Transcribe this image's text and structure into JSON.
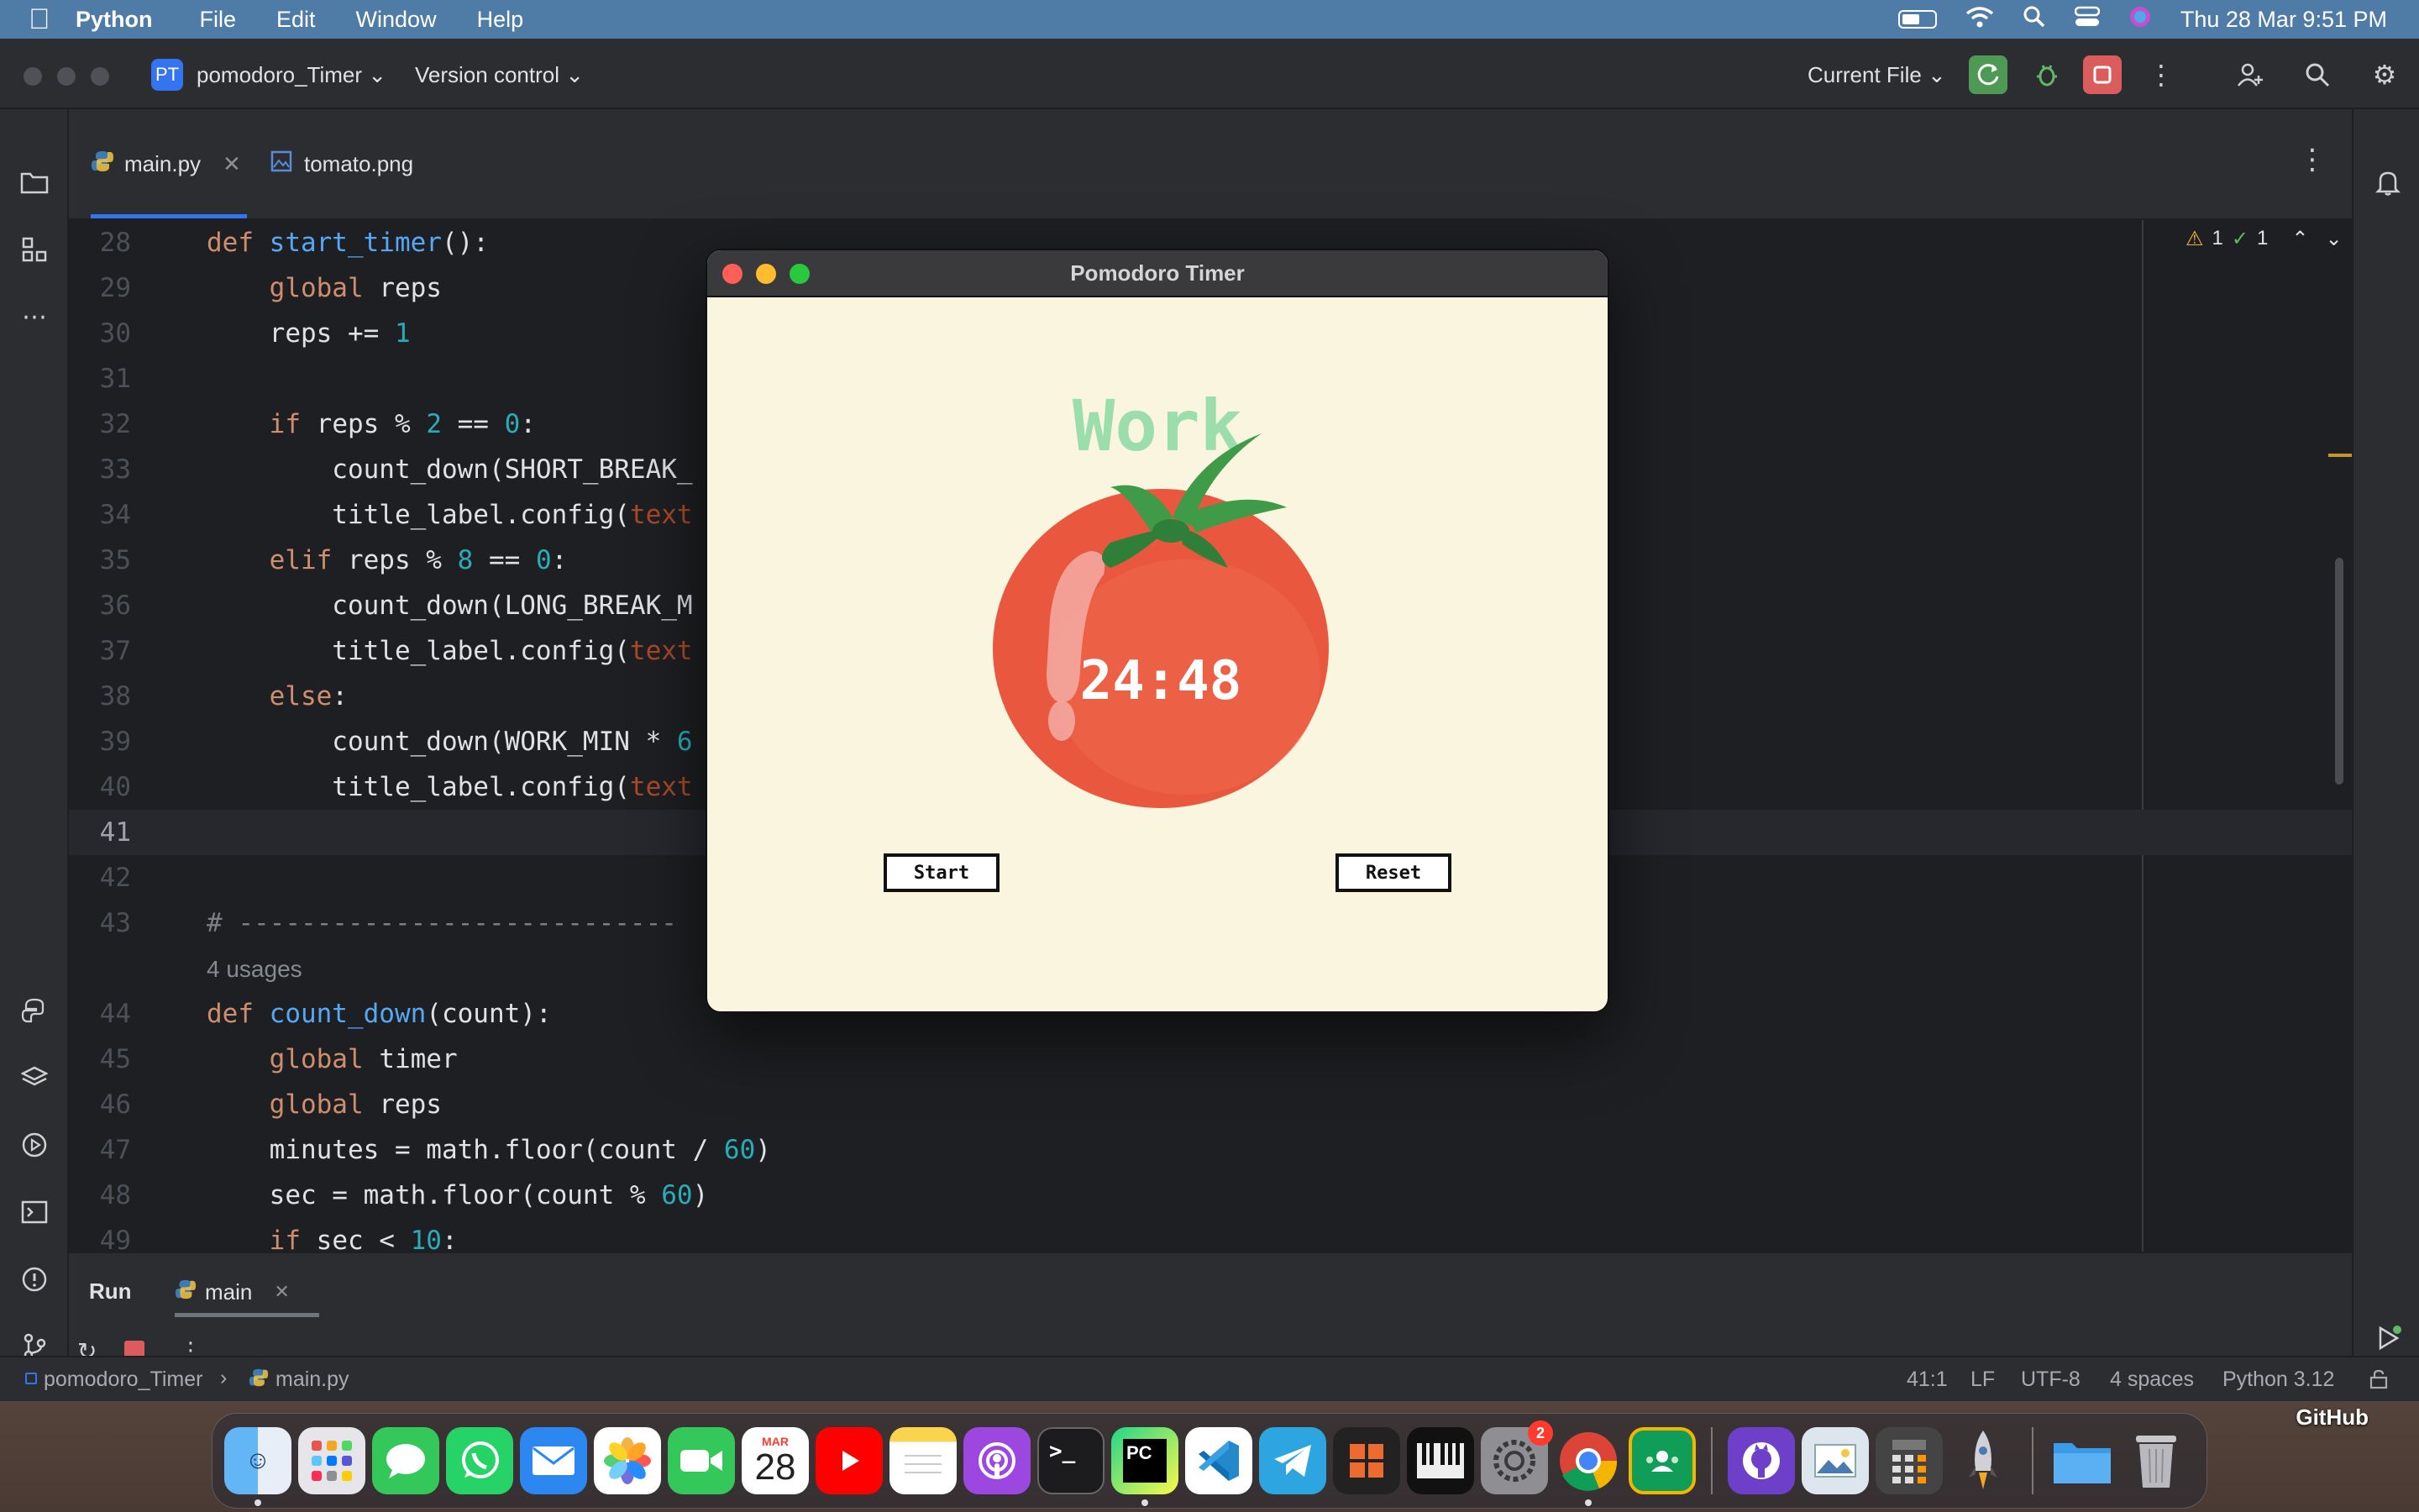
{
  "menubar": {
    "app": "Python",
    "items": [
      "File",
      "Edit",
      "Window",
      "Help"
    ],
    "datetime": "Thu 28 Mar  9:51 PM"
  },
  "ide": {
    "project_badge": "PT",
    "project_name": "pomodoro_Timer",
    "version_control": "Version control",
    "run_config": "Current File",
    "tabs": [
      {
        "label": "main.py",
        "active": true
      },
      {
        "label": "tomato.png",
        "active": false
      }
    ],
    "inspections": {
      "warnings": "1",
      "ok": "1"
    },
    "code": [
      {
        "n": "28",
        "tokens": [
          [
            "kw",
            "def "
          ],
          [
            "fn",
            "start_timer"
          ],
          [
            "",
            "():"
          ]
        ]
      },
      {
        "n": "29",
        "tokens": [
          [
            "",
            "    "
          ],
          [
            "kw",
            "global "
          ],
          [
            "",
            "reps"
          ]
        ]
      },
      {
        "n": "30",
        "tokens": [
          [
            "",
            "    reps += "
          ],
          [
            "num",
            "1"
          ]
        ]
      },
      {
        "n": "31",
        "tokens": []
      },
      {
        "n": "32",
        "tokens": [
          [
            "",
            "    "
          ],
          [
            "kw",
            "if "
          ],
          [
            "",
            "reps % "
          ],
          [
            "num",
            "2"
          ],
          [
            "",
            " == "
          ],
          [
            "num",
            "0"
          ],
          [
            "",
            ":"
          ]
        ]
      },
      {
        "n": "33",
        "tokens": [
          [
            "",
            "        count_down(SHORT_BREAK_"
          ]
        ]
      },
      {
        "n": "34",
        "tokens": [
          [
            "",
            "        title_label.config("
          ],
          [
            "kwarg",
            "text"
          ]
        ]
      },
      {
        "n": "35",
        "tokens": [
          [
            "",
            "    "
          ],
          [
            "kw",
            "elif "
          ],
          [
            "",
            "reps % "
          ],
          [
            "num",
            "8"
          ],
          [
            "",
            " == "
          ],
          [
            "num",
            "0"
          ],
          [
            "",
            ":"
          ]
        ]
      },
      {
        "n": "36",
        "tokens": [
          [
            "",
            "        count_down(LONG_BREAK_M"
          ]
        ]
      },
      {
        "n": "37",
        "tokens": [
          [
            "",
            "        title_label.config("
          ],
          [
            "kwarg",
            "text"
          ]
        ]
      },
      {
        "n": "38",
        "tokens": [
          [
            "",
            "    "
          ],
          [
            "kw",
            "else"
          ],
          [
            "",
            ":"
          ]
        ]
      },
      {
        "n": "39",
        "tokens": [
          [
            "",
            "        count_down(WORK_MIN * "
          ],
          [
            "num",
            "6"
          ]
        ]
      },
      {
        "n": "40",
        "tokens": [
          [
            "",
            "        title_label.config("
          ],
          [
            "kwarg",
            "text"
          ]
        ]
      },
      {
        "n": "41",
        "tokens": [],
        "current": true
      },
      {
        "n": "42",
        "tokens": []
      },
      {
        "n": "43",
        "tokens": [
          [
            "cmt",
            "# ---------------------------- "
          ]
        ]
      },
      {
        "n": "",
        "hint": "4 usages"
      },
      {
        "n": "44",
        "tokens": [
          [
            "kw",
            "def "
          ],
          [
            "fn",
            "count_down"
          ],
          [
            "",
            "(count):"
          ]
        ]
      },
      {
        "n": "45",
        "tokens": [
          [
            "",
            "    "
          ],
          [
            "kw",
            "global "
          ],
          [
            "",
            "timer"
          ]
        ]
      },
      {
        "n": "46",
        "tokens": [
          [
            "",
            "    "
          ],
          [
            "kw",
            "global "
          ],
          [
            "",
            "reps"
          ]
        ]
      },
      {
        "n": "47",
        "tokens": [
          [
            "",
            "    minutes = math.floor(count / "
          ],
          [
            "num",
            "60"
          ],
          [
            "",
            ")"
          ]
        ]
      },
      {
        "n": "48",
        "tokens": [
          [
            "",
            "    sec = math.floor(count % "
          ],
          [
            "num",
            "60"
          ],
          [
            "",
            ")"
          ]
        ]
      },
      {
        "n": "49",
        "tokens": [
          [
            "",
            "    "
          ],
          [
            "kw",
            "if "
          ],
          [
            "",
            "sec < "
          ],
          [
            "num",
            "10"
          ],
          [
            "",
            ":"
          ]
        ]
      }
    ],
    "run_panel": {
      "title": "Run",
      "tab": "main"
    },
    "status": {
      "breadcrumb_project": "pomodoro_Timer",
      "breadcrumb_file": "main.py",
      "position": "41:1",
      "line_sep": "LF",
      "encoding": "UTF-8",
      "indent": "4 spaces",
      "interpreter": "Python 3.12"
    }
  },
  "tk_window": {
    "title": "Pomodoro Timer",
    "heading": "Work",
    "timer": "24:48",
    "start_label": "Start",
    "reset_label": "Reset"
  },
  "dock": {
    "calendar_month": "MAR",
    "calendar_day": "28",
    "settings_badge": "2",
    "github_label": "GitHub"
  },
  "colors": {
    "accent": "#3574f0",
    "tk_bg": "#f9f5de",
    "heading_green": "#9bdeac",
    "tomato_red": "#e9573f"
  }
}
